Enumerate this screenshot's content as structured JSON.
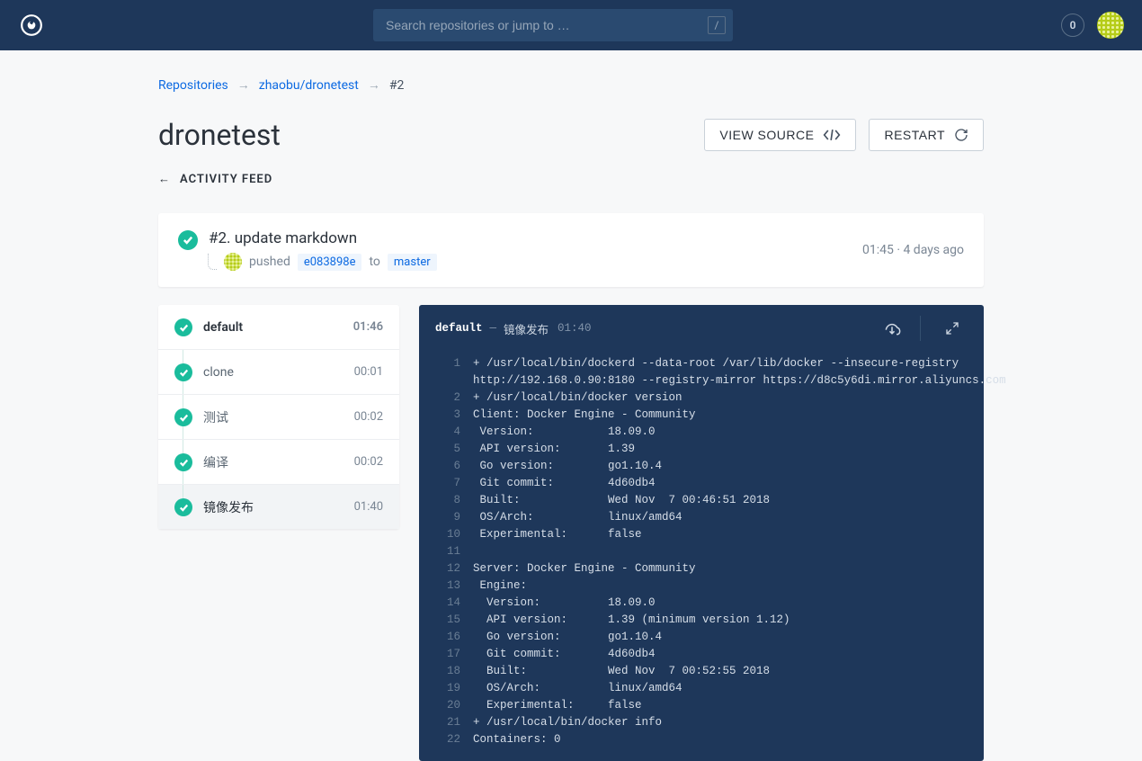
{
  "header": {
    "search_placeholder": "Search repositories or jump to …",
    "search_key": "/",
    "notif_count": "0"
  },
  "breadcrumb": {
    "root": "Repositories",
    "repo": "zhaobu/dronetest",
    "build": "#2"
  },
  "page": {
    "title": "dronetest",
    "view_source": "VIEW SOURCE",
    "restart": "RESTART",
    "activity_feed": "ACTIVITY FEED"
  },
  "build": {
    "title": "#2. update markdown",
    "pushed_label": "pushed",
    "commit": "e083898e",
    "to_label": "to",
    "branch": "master",
    "duration": "01:45",
    "when": "4 days ago"
  },
  "pipeline": {
    "name": "default",
    "total": "01:46",
    "steps": [
      {
        "name": "clone",
        "time": "00:01"
      },
      {
        "name": "测试",
        "time": "00:02"
      },
      {
        "name": "编译",
        "time": "00:02"
      },
      {
        "name": "镜像发布",
        "time": "01:40"
      }
    ],
    "active_step": "镜像发布",
    "active_time": "01:40"
  },
  "log": {
    "lines": [
      "+ /usr/local/bin/dockerd --data-root /var/lib/docker --insecure-registry",
      "http://192.168.0.90:8180 --registry-mirror https://d8c5y6di.mirror.aliyuncs.com",
      "+ /usr/local/bin/docker version",
      "Client: Docker Engine - Community",
      " Version:           18.09.0",
      " API version:       1.39",
      " Go version:        go1.10.4",
      " Git commit:        4d60db4",
      " Built:             Wed Nov  7 00:46:51 2018",
      " OS/Arch:           linux/amd64",
      " Experimental:      false",
      "",
      "Server: Docker Engine - Community",
      " Engine:",
      "  Version:          18.09.0",
      "  API version:      1.39 (minimum version 1.12)",
      "  Go version:       go1.10.4",
      "  Git commit:       4d60db4",
      "  Built:            Wed Nov  7 00:52:55 2018",
      "  OS/Arch:          linux/amd64",
      "  Experimental:     false",
      "+ /usr/local/bin/docker info",
      "Containers: 0"
    ],
    "line_numbers": [
      "1",
      "",
      "2",
      "3",
      "4",
      "5",
      "6",
      "7",
      "8",
      "9",
      "10",
      "11",
      "12",
      "13",
      "14",
      "15",
      "16",
      "17",
      "18",
      "19",
      "20",
      "21",
      "22"
    ]
  }
}
